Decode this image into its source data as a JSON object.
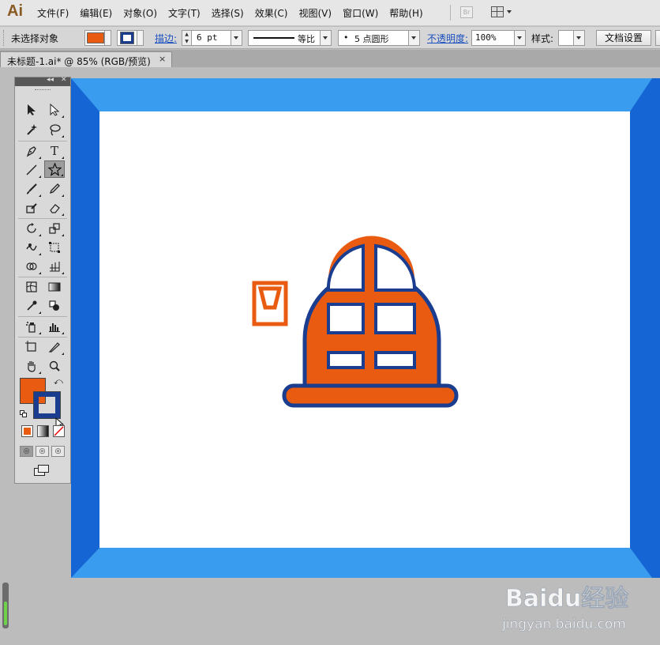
{
  "app": {
    "logo": "Ai"
  },
  "menu": {
    "items": [
      "文件(F)",
      "编辑(E)",
      "对象(O)",
      "文字(T)",
      "选择(S)",
      "效果(C)",
      "视图(V)",
      "窗口(W)",
      "帮助(H)"
    ],
    "bridge_label": "Br"
  },
  "control": {
    "selection_status": "未选择对象",
    "stroke_label": "描边:",
    "stroke_weight": "6 pt",
    "profile_label": "等比",
    "brush_label": "5 点圆形",
    "opacity_label": "不透明度:",
    "opacity_value": "100%",
    "style_label": "样式:",
    "doc_setup_button": "文档设置"
  },
  "document": {
    "tab_title": "未标题-1.ai* @ 85% (RGB/预览)",
    "close_icon": "×"
  },
  "colors": {
    "fill": "#e85b10",
    "stroke": "#1a3d8f",
    "frame_light": "#3a9cee",
    "frame_dark": "#1566d4",
    "artboard": "#ffffff"
  },
  "tools": {
    "icons": [
      "selection-tool-icon",
      "direct-selection-tool-icon",
      "magic-wand-tool-icon",
      "lasso-tool-icon",
      "pen-tool-icon",
      "type-tool-icon",
      "line-segment-tool-icon",
      "star-tool-icon",
      "paintbrush-tool-icon",
      "pencil-tool-icon",
      "blob-brush-tool-icon",
      "eraser-tool-icon",
      "rotate-tool-icon",
      "scale-tool-icon",
      "warp-tool-icon",
      "free-transform-tool-icon",
      "shape-builder-tool-icon",
      "perspective-grid-tool-icon",
      "mesh-tool-icon",
      "gradient-tool-icon",
      "eyedropper-tool-icon",
      "blend-tool-icon",
      "symbol-sprayer-tool-icon",
      "column-graph-tool-icon",
      "artboard-tool-icon",
      "slice-tool-icon",
      "hand-tool-icon",
      "zoom-tool-icon"
    ],
    "active": "star-tool-icon"
  },
  "watermark": {
    "brand": "Baidu经验",
    "url": "jingyan.baidu.com"
  }
}
